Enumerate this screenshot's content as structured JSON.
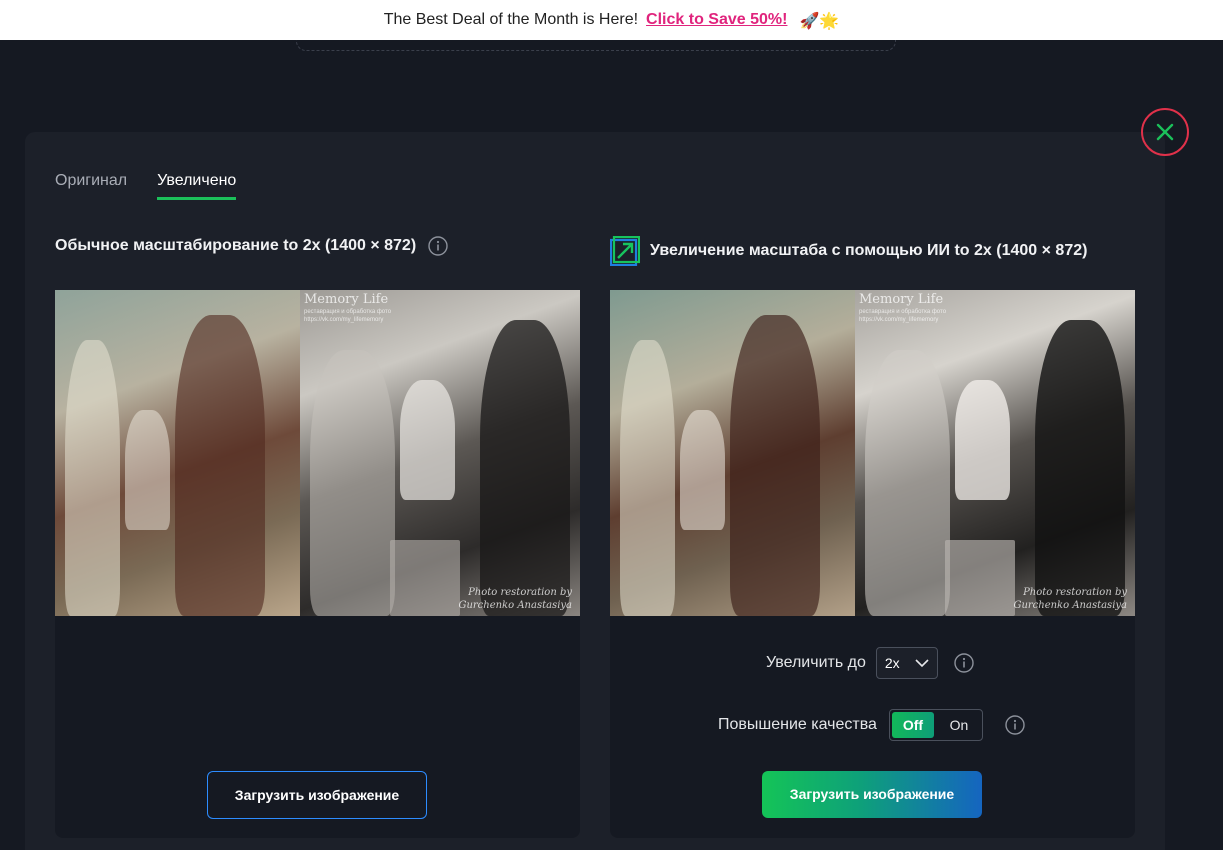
{
  "promo": {
    "text": "The Best Deal of the Month is Here!",
    "link": "Click to Save 50%!",
    "emoji": "🚀🌟"
  },
  "tabs": [
    {
      "label": "Оригинал",
      "active": false
    },
    {
      "label": "Увеличено",
      "active": true
    }
  ],
  "left_panel": {
    "title": "Обычное масштабирование to 2x (1400 × 872)",
    "photo": {
      "watermark_title": "Memory Life",
      "watermark_sub1": "реставрация и обработка фото",
      "watermark_sub2": "https://vk.com/my_lifememory",
      "signature_line1": "Photo restoration by",
      "signature_line2": "Gurchenko Anastasiya"
    },
    "button_label": "Загрузить изображение"
  },
  "right_panel": {
    "title": "Увеличение масштаба с помощью ИИ to 2x (1400 × 872)",
    "photo": {
      "watermark_title": "Memory Life",
      "watermark_sub1": "реставрация и обработка фото",
      "watermark_sub2": "https://vk.com/my_lifememory",
      "signature_line1": "Photo restoration by",
      "signature_line2": "Gurchenko Anastasiya"
    },
    "scale_label": "Увеличить до",
    "scale_value": "2x",
    "quality_label": "Повышение качества",
    "quality_off": "Off",
    "quality_on": "On",
    "quality_selected": "Off",
    "button_label": "Загрузить изображение"
  },
  "colors": {
    "background": "#151922",
    "modal": "#1c2029",
    "accent_green": "#1bc05a",
    "accent_blue": "#2d8cff",
    "close_red": "#e0314a",
    "promo_pink": "#e0247d"
  }
}
